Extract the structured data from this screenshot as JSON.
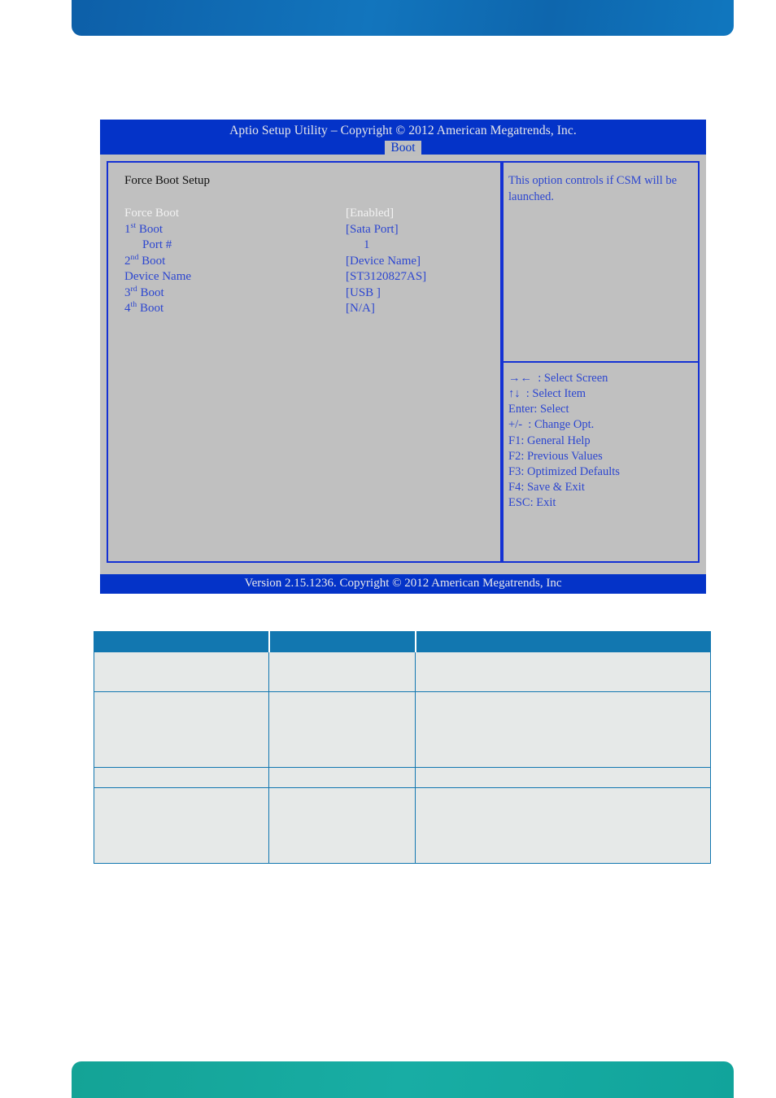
{
  "banners": {
    "top_color": "#1275bd",
    "bottom_color": "#16a79c"
  },
  "bios": {
    "title": "Aptio Setup Utility  –   Copyright © 2012 American Megatrends, Inc.",
    "active_tab": "Boot",
    "section_heading": "Force Boot Setup",
    "title_bar_color": "#0433c8",
    "panel_color": "#c0c0c0",
    "border_color": "#1431d4",
    "text_color": "#2c46d0",
    "selected_text_color": "#f2f2f2",
    "options": [
      {
        "label": "Force Boot",
        "sup": "",
        "value": "[Enabled]",
        "selected": true,
        "indent": false
      },
      {
        "label": "1",
        "sup": "st",
        "label_tail": " Boot",
        "value": "[Sata Port]",
        "selected": false,
        "indent": false
      },
      {
        "label": "Port #",
        "sup": "",
        "value": "1",
        "selected": false,
        "indent": true
      },
      {
        "label": "2",
        "sup": "nd",
        "label_tail": " Boot",
        "value": "[Device Name]",
        "selected": false,
        "indent": false
      },
      {
        "label": "Device Name",
        "sup": "",
        "value": "[ST3120827AS]",
        "selected": false,
        "indent": false
      },
      {
        "label": "3",
        "sup": "rd",
        "label_tail": " Boot",
        "value": "[USB ]",
        "selected": false,
        "indent": false
      },
      {
        "label": "4",
        "sup": "th",
        "label_tail": " Boot",
        "value": "[N/A]",
        "selected": false,
        "indent": false
      }
    ],
    "help_text": "This option controls if CSM will be launched.",
    "keys": [
      "→←  : Select Screen",
      "↑↓  : Select Item",
      "Enter: Select",
      "+/-  : Change Opt.",
      "F1: General Help",
      "F2: Previous Values",
      "F3: Optimized Defaults",
      "F4: Save & Exit",
      "ESC: Exit"
    ],
    "footer": "Version 2.15.1236. Copyright © 2012 American Megatrends, Inc"
  },
  "table": {
    "header_color": "#1277b0",
    "row_color": "#e6e9e8",
    "headers": [
      "",
      "",
      ""
    ],
    "rows": [
      [
        "",
        "",
        ""
      ],
      [
        "",
        "",
        ""
      ],
      [
        "",
        "",
        ""
      ],
      [
        "",
        "",
        ""
      ]
    ]
  }
}
